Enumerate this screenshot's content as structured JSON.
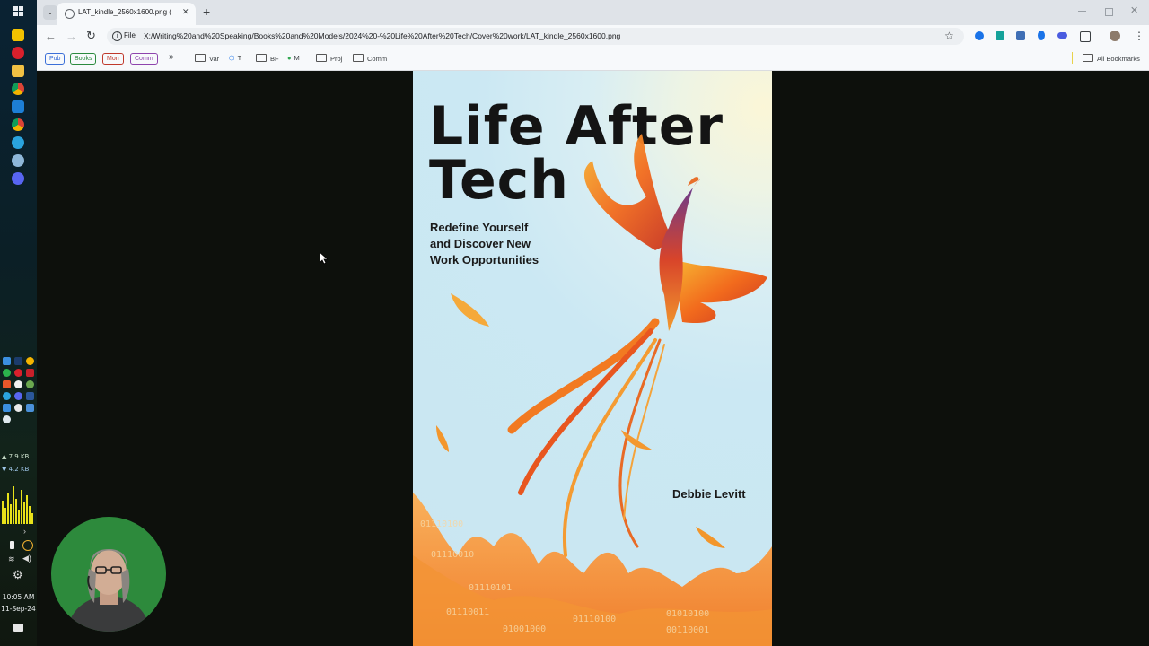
{
  "browser": {
    "tab_title": "LAT_kindle_2560x1600.png (16",
    "new_tab_symbol": "+",
    "close_symbol": "✕",
    "file_label": "File",
    "url": "X:/Writing%20and%20Speaking/Books%20and%20Models/2024%20-%20Life%20After%20Tech/Cover%20work/LAT_kindle_2560x1600.png",
    "all_bookmarks": "All Bookmarks",
    "more_symbol": "»"
  },
  "bookmarks": {
    "pills": [
      {
        "label": "Pub",
        "color": "#3b6fd8"
      },
      {
        "label": "Books",
        "color": "#2b8a3e"
      },
      {
        "label": "Mon",
        "color": "#c0392b"
      },
      {
        "label": "Comm",
        "color": "#8e44ad"
      }
    ],
    "items": [
      "Var",
      "T",
      "BF",
      "M",
      "Proj",
      "Comm"
    ]
  },
  "cover": {
    "title_line1": "Life After",
    "title_line2": "Tech",
    "subtitle_line1": "Redefine Yourself",
    "subtitle_line2": "and Discover New",
    "subtitle_line3": "Work Opportunities",
    "author": "Debbie Levitt",
    "binary": [
      "01110100",
      "01110010",
      "01110101",
      "01110011",
      "01001000",
      "01110100",
      "01010100",
      "00110001"
    ]
  },
  "taskbar": {
    "upload": "▲ 7.9 KB",
    "download": "▼ 4.2 KB",
    "time": "10:05 AM",
    "date": "11-Sep-24"
  }
}
